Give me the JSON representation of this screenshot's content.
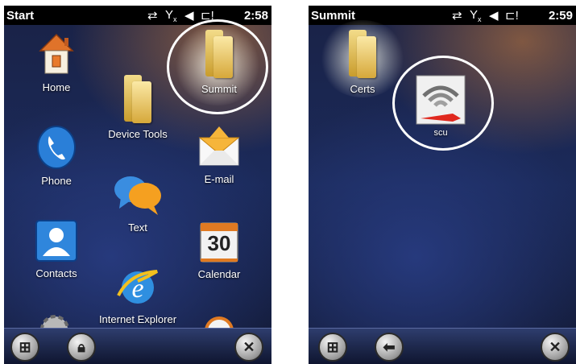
{
  "screen1": {
    "status": {
      "title": "Start",
      "time": "2:58"
    },
    "tiles": {
      "home": "Home",
      "summit": "Summit",
      "device_tools": "Device Tools",
      "phone": "Phone",
      "email": "E-mail",
      "text": "Text",
      "contacts": "Contacts",
      "calendar": "Calendar",
      "calendar_day": "30",
      "ie": "Internet Explorer"
    },
    "taskbar": {
      "windows": "windows-logo-icon",
      "lock": "lock-icon",
      "close": "close-icon"
    }
  },
  "screen2": {
    "status": {
      "title": "Summit",
      "time": "2:59"
    },
    "tiles": {
      "certs": "Certs",
      "scu": "scu"
    },
    "taskbar": {
      "windows": "windows-logo-icon",
      "back": "back-arrow-icon",
      "close": "close-icon"
    }
  },
  "colors": {
    "status_bar": "#000000",
    "highlight_ring": "#ffffff",
    "folder": "#e8c85c",
    "scu_red": "#e0281e"
  }
}
